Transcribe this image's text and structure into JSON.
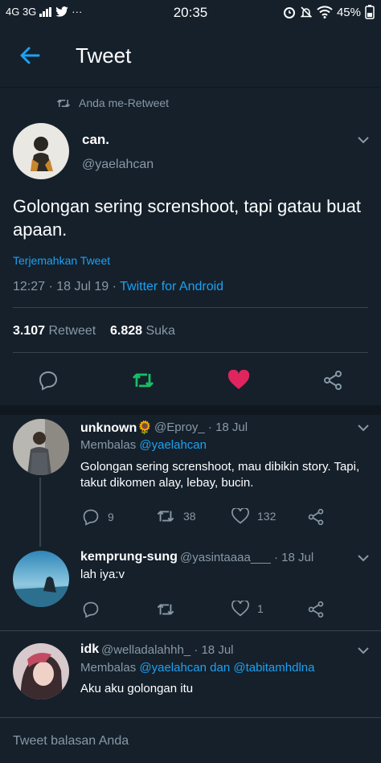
{
  "status": {
    "left": "4G 3G",
    "time": "20:35",
    "battery": "45%"
  },
  "header": {
    "title": "Tweet"
  },
  "retweet_banner": "Anda me-Retweet",
  "main_tweet": {
    "name": "can.",
    "handle": "@yaelahcan",
    "text": "Golongan sering screnshoot, tapi gatau buat apaan.",
    "translate": "Terjemahkan Tweet",
    "time": "12:27 · 18 Jul 19 ·",
    "source": "Twitter for Android",
    "retweets": "3.107",
    "retweets_label": "Retweet",
    "likes": "6.828",
    "likes_label": "Suka"
  },
  "replies": [
    {
      "name": "unknown🌻",
      "handle": "@Eproy_ · 18 Jul",
      "replying": "Membalas",
      "mentions": "@yaelahcan",
      "text": "Golongan sering screnshoot, mau dibikin story. Tapi, takut dikomen alay, lebay, bucin.",
      "replies": "9",
      "retweets": "38",
      "likes": "132"
    },
    {
      "name": "kemprung-sung",
      "handle": "@yasintaaaa___ · 18 Jul",
      "text": "lah iya:v",
      "likes": "1"
    },
    {
      "name": "idk",
      "handle": "@welladalahhh_ · 18 Jul",
      "replying": "Membalas",
      "mentions": "@yaelahcan dan @tabitamhdlna",
      "text": "Aku aku golongan itu"
    }
  ],
  "reply_box": {
    "placeholder": "Tweet balasan Anda"
  },
  "colors": {
    "bg": "#15202b",
    "accent": "#1da1f2",
    "retweet": "#17bf63",
    "like": "#e0245e",
    "muted": "#8899a6"
  }
}
